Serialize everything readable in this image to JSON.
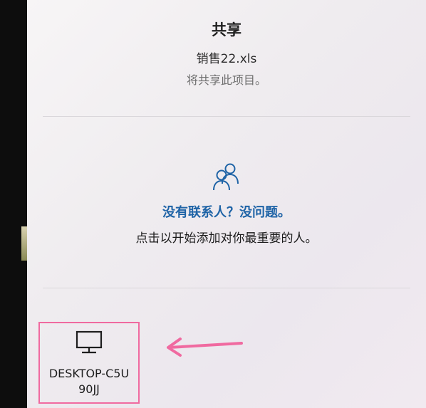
{
  "share": {
    "title": "共享",
    "filename": "销售22.xls",
    "subtitle": "将共享此项目。"
  },
  "contacts": {
    "icon": "people-icon",
    "heading": "没有联系人？没问题。",
    "hint": "点击以开始添加对你最重要的人。"
  },
  "device": {
    "icon": "monitor-icon",
    "name": "DESKTOP-C5U90JJ"
  },
  "colors": {
    "accent": "#1e63a6",
    "highlight": "#f06aa0"
  }
}
